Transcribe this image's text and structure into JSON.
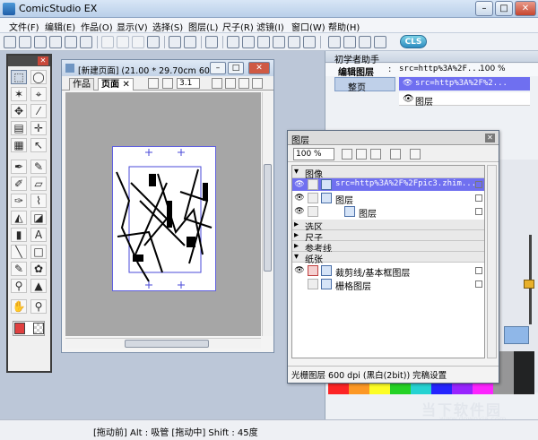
{
  "window": {
    "title": "ComicStudio EX"
  },
  "menu": [
    "文件(F)",
    "编辑(E)",
    "作品(O)",
    "显示(V)",
    "选择(S)",
    "图层(L)",
    "尺子(R)",
    "滤镜(I)",
    "窗口(W)",
    "帮助(H)"
  ],
  "toolbar": {
    "badge": "CLS"
  },
  "document": {
    "title": "[新建页面] (21.00 * 29.70cm 60...",
    "tabs": [
      "作品",
      "页面"
    ],
    "tab_close": "✕",
    "page_number": "3.1"
  },
  "assistant": {
    "title": "初学者助手",
    "current_layer_label": "编辑图层",
    "colon": ":",
    "current_layer_value": "src=http%3A%2F...",
    "zoom": "100 %",
    "page_item": "整页",
    "layers": [
      "src=http%3A%2F%2...",
      "图层"
    ]
  },
  "layer_palette": {
    "title": "图层",
    "opacity": "100 %",
    "groups": {
      "image": "图像",
      "selection": "选区",
      "ruler": "尺子",
      "guide": "参考线",
      "paper": "纸张"
    },
    "image_layers": [
      "src=http%3A%2F%2Fpic3.zhim...",
      "图层",
      "图层"
    ],
    "paper_layers": [
      "裁剪线/基本框图层",
      "栅格图层"
    ],
    "status": "光栅图层 600 dpi (黑白(2bit)) 完稿设置"
  },
  "statusbar": {
    "text": "[拖动前] Alt : 吸管    [拖动中] Shift : 45度"
  },
  "watermark": {
    "text": "当下软件园",
    "url": "www.downxia.com"
  },
  "colors": {
    "selection": "#7070f0",
    "accent": "#4e9ad8"
  }
}
